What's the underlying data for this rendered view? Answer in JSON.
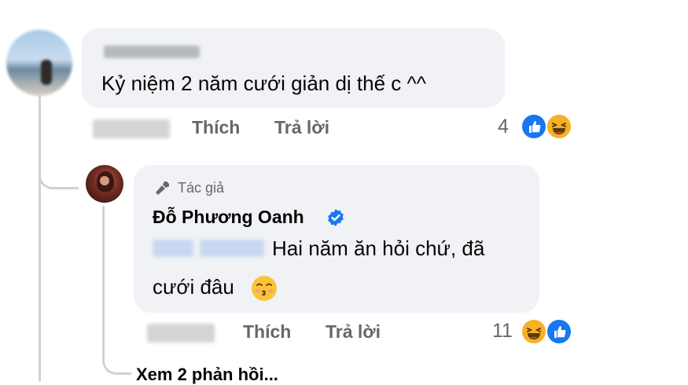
{
  "comment": {
    "text": "Kỷ niệm 2 năm cưới giản dị thế c ^^",
    "like_label": "Thích",
    "reply_label": "Trả lời",
    "reaction_count": "4",
    "reactions": [
      "like-icon",
      "haha-icon"
    ]
  },
  "reply": {
    "badge_icon": "microphone-icon",
    "badge_label": "Tác giả",
    "author": "Đỗ Phương Oanh",
    "verified_icon": "verified-badge-icon",
    "text_line1": "Hai năm ăn hỏi chứ, đã",
    "text_line2": "cưới đâu",
    "emoji": "kissing-face-icon",
    "like_label": "Thích",
    "reply_label": "Trả lời",
    "reaction_count": "11",
    "reactions": [
      "haha-icon",
      "like-icon"
    ]
  },
  "thread": {
    "view_more_label": "Xem 2 phản hồi..."
  },
  "colors": {
    "bubble": "#f0f2f5",
    "meta_text": "#65676b",
    "like_blue": "#1877f2",
    "haha_yellow": "#f7b125",
    "thread_line": "#d0d2d6"
  }
}
